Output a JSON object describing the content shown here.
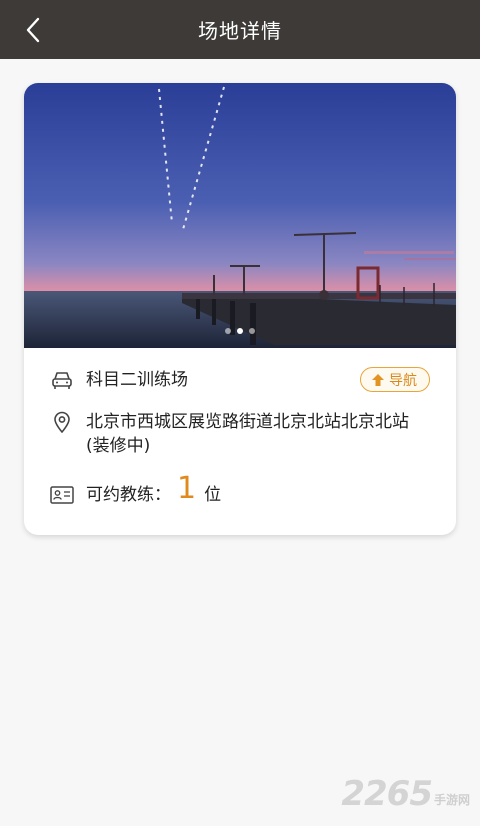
{
  "header": {
    "title": "场地详情"
  },
  "venue": {
    "name": "科目二训练场",
    "address": "北京市西城区展览路街道北京北站北京北站(装修中)",
    "coach_label": "可约教练：",
    "coach_count": "1",
    "coach_unit": "位",
    "nav_label": "导航"
  },
  "banner": {
    "slides": 3,
    "active_slide": 1
  },
  "watermark": {
    "number": "2265",
    "suffix": "手游网"
  },
  "colors": {
    "header_bg": "#3d3a38",
    "accent": "#e08a1d",
    "page_bg": "#f7f7f7"
  }
}
